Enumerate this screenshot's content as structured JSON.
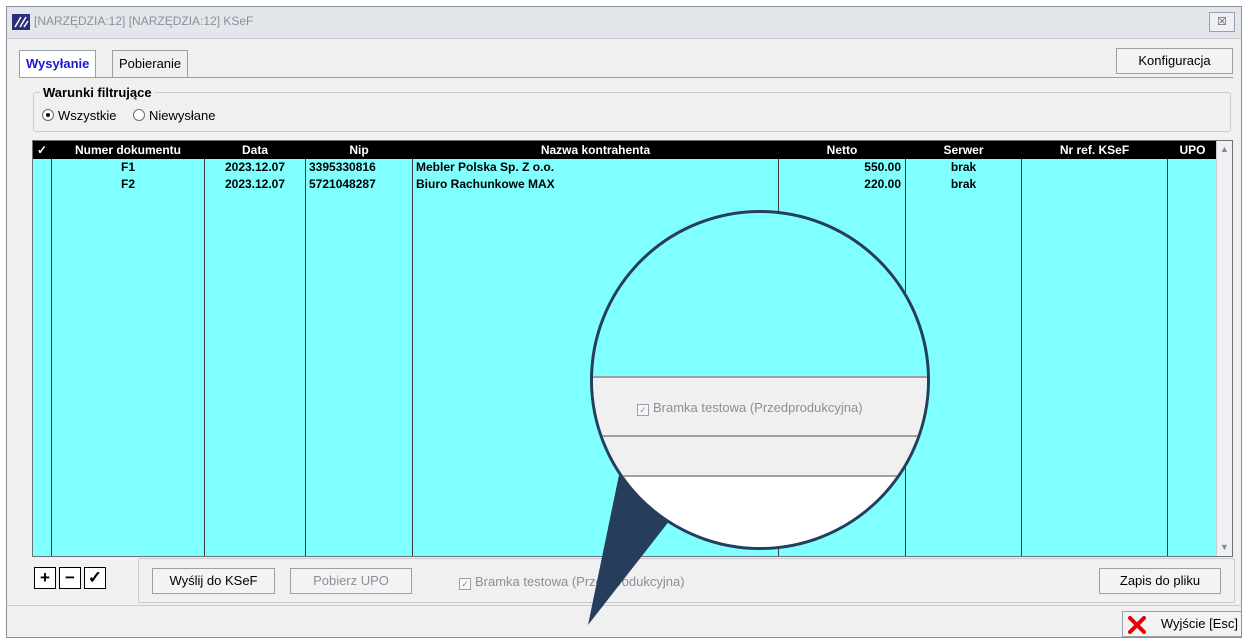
{
  "window": {
    "title": "[NARZĘDZIA:12]  [NARZĘDZIA:12]  KSeF",
    "close_glyph": "☒"
  },
  "tabs": [
    {
      "label": "Wysyłanie",
      "active": true
    },
    {
      "label": "Pobieranie",
      "active": false
    }
  ],
  "toolbar": {
    "config_label": "Konfiguracja"
  },
  "filter": {
    "legend": "Warunki filtrujące",
    "options": [
      {
        "label": "Wszystkie",
        "selected": true
      },
      {
        "label": "Niewysłane",
        "selected": false
      }
    ]
  },
  "grid": {
    "columns": {
      "check": "✓",
      "number": "Numer dokumentu",
      "date": "Data",
      "nip": "Nip",
      "name": "Nazwa kontrahenta",
      "net": "Netto",
      "server": "Serwer",
      "ref": "Nr ref. KSeF",
      "upo": "UPO"
    },
    "rows": [
      {
        "number": "F1",
        "date": "2023.12.07",
        "nip": "3395330816",
        "name": "Mebler Polska Sp. Z o.o.",
        "net": "550.00",
        "server": "brak",
        "ref": "",
        "upo": ""
      },
      {
        "number": "F2",
        "date": "2023.12.07",
        "nip": "5721048287",
        "name": "Biuro Rachunkowe MAX",
        "net": "220.00",
        "server": "brak",
        "ref": "",
        "upo": ""
      }
    ],
    "background": "#80ffff"
  },
  "icon_buttons": {
    "add": "+",
    "remove": "−",
    "check": "✓"
  },
  "actions": {
    "send_label": "Wyślij do KSeF",
    "upo_label": "Pobierz UPO",
    "test_gateway_label": "Bramka testowa (Przedprodukcyjna)",
    "test_gateway_checked": true,
    "save_label": "Zapis do pliku",
    "exit_label": "Wyjście  [Esc]"
  },
  "magnifier": {
    "text": "Bramka testowa (Przedprodukcyjna)"
  },
  "colors": {
    "accent": "#1a1acc",
    "header_bg": "#000000",
    "magnifier_border": "#263d5c",
    "exit_icon": "#e60000"
  }
}
